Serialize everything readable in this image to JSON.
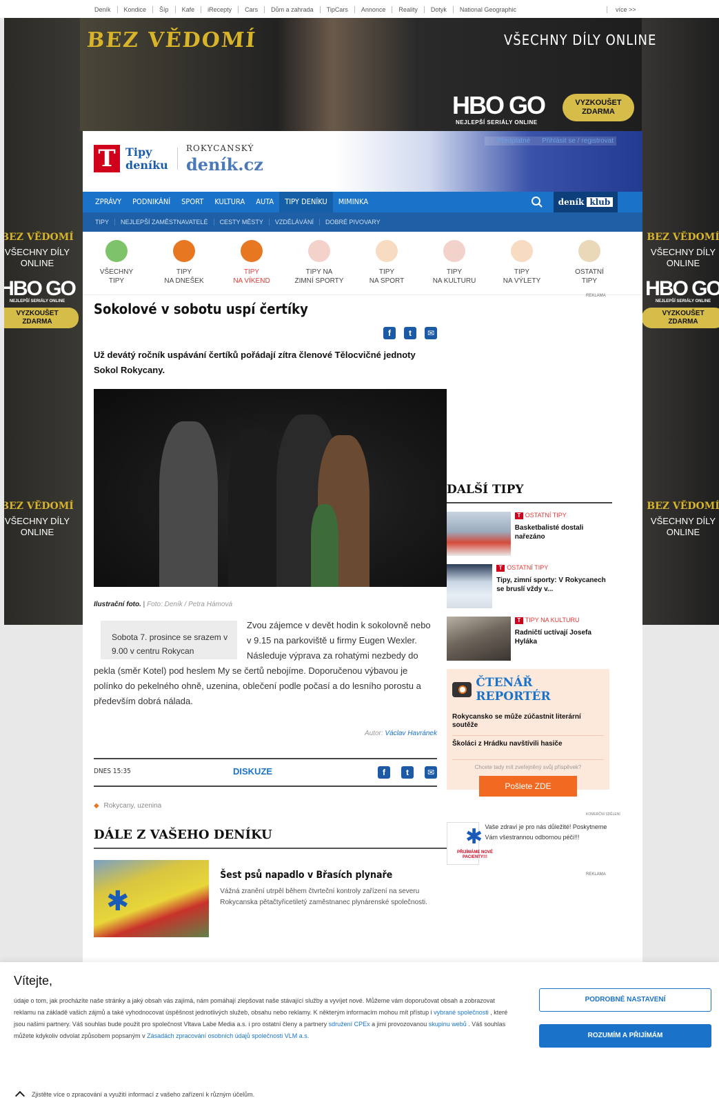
{
  "netbar": {
    "links": [
      "Deník",
      "Kondice",
      "Šíp",
      "Kafe",
      "iRecepty",
      "Cars",
      "Dům a zahrada",
      "TipCars",
      "Annonce",
      "Reality",
      "Dotyk",
      "National Geographic"
    ],
    "more": "více >>"
  },
  "ad": {
    "title": "BEZ VĚDOMÍ",
    "online": "VŠECHNY DÍLY ONLINE",
    "logo": "HBO GO",
    "logo_sub": "NEJLEPŠÍ SERIÁLY ONLINE",
    "cta": "VYZKOUŠET ZDARMA",
    "side_title": "BEZ VĚDOMÍ",
    "side_online": "VŠECHNY DÍLY ONLINE"
  },
  "header": {
    "logo_letter": "T",
    "logo_text_1": "Tipy",
    "logo_text_2": "deníku",
    "region": "ROKYCANSKÝ",
    "site": "deník.cz",
    "predplatne": "Předplatné",
    "login": "Přihlásit se / registrovat"
  },
  "nav1": [
    "ZPRÁVY",
    "PODNIKÁNÍ",
    "SPORT",
    "KULTURA",
    "AUTA",
    "TIPY DENÍKU",
    "MIMINKA"
  ],
  "nav1_active": "TIPY DENÍKU",
  "klub": {
    "a": "deník",
    "b": "klub"
  },
  "nav2": [
    "TIPY",
    "NEJLEPŠÍ ZAMĚSTNAVATELÉ",
    "CESTY MĚSTY",
    "VZDĚLÁVÁNÍ",
    "DOBRÉ PIVOVARY"
  ],
  "cats": [
    {
      "l1": "VŠECHNY",
      "l2": "TIPY",
      "color": "#7cc36a"
    },
    {
      "l1": "TIPY",
      "l2": "NA DNEŠEK",
      "color": "#e87722"
    },
    {
      "l1": "TIPY",
      "l2": "NA VÍKEND",
      "color": "#e87722"
    },
    {
      "l1": "TIPY NA",
      "l2": "ZIMNÍ SPORTY",
      "color": "#d0021b"
    },
    {
      "l1": "TIPY",
      "l2": "NA SPORT",
      "color": "#e87722"
    },
    {
      "l1": "TIPY",
      "l2": "NA KULTURU",
      "color": "#d0021b"
    },
    {
      "l1": "TIPY",
      "l2": "NA VÝLETY",
      "color": "#e87722"
    },
    {
      "l1": "OSTATNÍ",
      "l2": "TIPY",
      "color": "#c9a14a"
    }
  ],
  "article": {
    "reklama": "REKLAMA",
    "title": "Sokolové v sobotu uspí čertíky",
    "perex": "Už devátý ročník uspávání čertíků pořádají zítra členové Tělocvičné jednoty Sokol Rokycany.",
    "caption_label": "Ilustrační foto.",
    "caption_credit": "Foto: Deník / Petra Hámová",
    "infobox": "Sobota 7. prosince se srazem v 9.00 v centru Rokycan",
    "body": "Zvou zájemce v devět hodin k sokolovně nebo v 9.15 na parkoviště u firmy Eugen Wexler. Následuje výprava za rohatými nezbedy do pekla (směr Kotel) pod heslem My se čertů nebojíme. Doporučenou výbavou je polínko do pekelného ohně, uzenina, oblečení podle počasí a do lesního porostu a především dobrá nálada.",
    "author_label": "Autor:",
    "author": "Václav Havránek",
    "date": "DNES 15:35",
    "diskuze": "DISKUZE",
    "tags": "Rokycany, uzenina"
  },
  "more": {
    "title": "DÁLE Z VAŠEHO DENÍKU",
    "items": [
      {
        "title": "Šest psů napadlo v Břasích plynaře",
        "desc": "Vážná zranění utrpěl během čtvrteční kontroly zařízení na severu Rokycanska pětačtyřicetiletý zaměstnanec plynárenské společnosti."
      }
    ]
  },
  "dalsi": {
    "title": "DALŠÍ TIPY",
    "items": [
      {
        "cat": "OSTATNÍ TIPY",
        "title": "Basketbalisté dostali nařezáno",
        "color": "#b7c6d6"
      },
      {
        "cat": "OSTATNÍ TIPY",
        "title": "Tipy, zimní sporty: V Rokycanech se bruslí vždy v...",
        "color": "#d7dfe8"
      },
      {
        "cat": "TIPY NA KULTURU",
        "title": "Radničtí uctívají Josefa Hyláka",
        "color": "#8a7a68"
      }
    ]
  },
  "reporter": {
    "title": "ČTENÁŘ REPORTÉR",
    "items": [
      "Rokycansko se může zúčastnit literární soutěže",
      "Školáci z Hrádku navštívili hasiče"
    ],
    "ask": "Chcete tady mít zveřejněný svůj příspěvek?",
    "button": "Pošlete ZDE"
  },
  "promo": {
    "label": "KOMERČNÍ SDĚLENÍ",
    "badge": "PŘIJÍMÁME NOVÉ PACIENTY!!!",
    "text": "Vaše zdraví je pro nás důležité! Poskytneme Vám všestrannou odbornou péči!!!",
    "reklama": "REKLAMA"
  },
  "cookie": {
    "title": "Vítejte,",
    "text_1": "údaje o tom, jak procházíte naše stránky a jaký obsah vás zajímá, nám pomáhají zlepšovat naše stávající služby a vyvíjet nové. Můžeme vám doporučovat obsah a zobrazovat reklamu na základě vašich zájmů a také vyhodnocovat úspěšnost jednotlivých služeb, obsahu nebo reklamy. K některým informacím mohou mít přístup i",
    "link_1": "vybrané společnosti",
    "text_2": ", které jsou našimi partnery. Váš souhlas bude použit pro společnost Vltava Labe Media a.s. i pro ostatní členy a partnery",
    "link_2": "sdružení CPEx",
    "text_3": "a jimi provozovanou",
    "link_3": "skupinu webů",
    "text_4": ". Váš souhlas můžete kdykoliv odvolat způsobem popsaným v",
    "link_4": "Zásadách zpracování osobních údajů společnosti VLM a.s.",
    "btn_settings": "PODROBNÉ NASTAVENÍ",
    "btn_accept": "ROZUMÍM A PŘIJÍMÁM",
    "more": "Zjistěte více o zpracování a využití informací z vašeho zařízení k různým účelům."
  }
}
